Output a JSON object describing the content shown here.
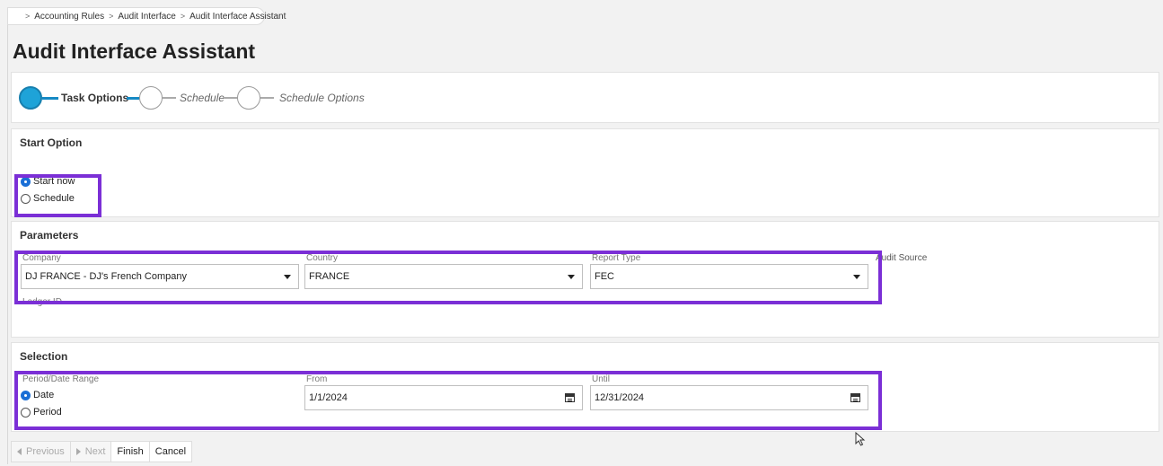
{
  "breadcrumb": {
    "home_icon": "home-dot-icon",
    "items": [
      "Accounting Rules",
      "Audit Interface",
      "Audit Interface Assistant"
    ]
  },
  "page": {
    "title": "Audit Interface Assistant"
  },
  "wizard": {
    "steps": [
      {
        "label": "Task Options",
        "state": "active"
      },
      {
        "label": "Schedule",
        "state": "inactive"
      },
      {
        "label": "Schedule Options",
        "state": "inactive"
      }
    ],
    "accent_color": "#1ea3d8"
  },
  "start_option": {
    "title": "Start Option",
    "options": [
      {
        "label": "Start now",
        "checked": true
      },
      {
        "label": "Schedule",
        "checked": false
      }
    ]
  },
  "parameters": {
    "title": "Parameters",
    "company": {
      "label": "Company",
      "value": "DJ FRANCE - DJ's French Company"
    },
    "country": {
      "label": "Country",
      "value": "FRANCE"
    },
    "report_type": {
      "label": "Report Type",
      "value": "FEC"
    },
    "audit_source": {
      "label": "Audit Source"
    },
    "ledger_id": {
      "label": "Ledger ID"
    }
  },
  "selection": {
    "title": "Selection",
    "period_label": "Period/Date Range",
    "options": [
      {
        "label": "Date",
        "checked": true
      },
      {
        "label": "Period",
        "checked": false
      }
    ],
    "from": {
      "label": "From",
      "value": "1/1/2024"
    },
    "until": {
      "label": "Until",
      "value": "12/31/2024"
    }
  },
  "footer": {
    "previous": "Previous",
    "next": "Next",
    "finish": "Finish",
    "cancel": "Cancel"
  },
  "highlight_color": "#7b2fd6"
}
